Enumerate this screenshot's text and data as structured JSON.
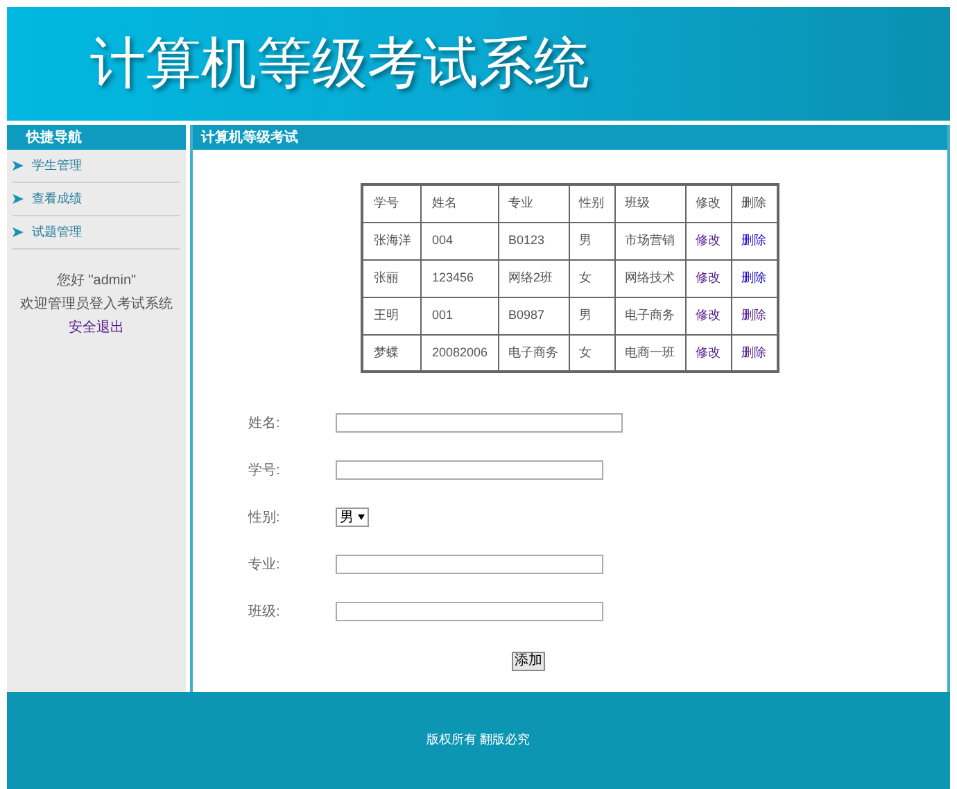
{
  "header": {
    "title": "计算机等级考试系统"
  },
  "sidebar": {
    "title": "快捷导航",
    "items": [
      {
        "label": "学生管理"
      },
      {
        "label": "查看成绩"
      },
      {
        "label": "试题管理"
      }
    ],
    "greeting": "您好 \"admin\"",
    "welcome": "欢迎管理员登入考试系统",
    "logout": "安全退出"
  },
  "main": {
    "title": "计算机等级考试",
    "table": {
      "columns": [
        "学号",
        "姓名",
        "专业",
        "性别",
        "班级",
        "修改",
        "删除"
      ],
      "rows": [
        {
          "cells": [
            "张海洋",
            "004",
            "B0123",
            "男",
            "市场营销"
          ],
          "edit": "修改",
          "delete": "删除",
          "delete_visited": false
        },
        {
          "cells": [
            "张丽",
            "123456",
            "网络2班",
            "女",
            "网络技术"
          ],
          "edit": "修改",
          "delete": "删除",
          "delete_visited": false
        },
        {
          "cells": [
            "王明",
            "001",
            "B0987",
            "男",
            "电子商务"
          ],
          "edit": "修改",
          "delete": "删除",
          "delete_visited": true
        },
        {
          "cells": [
            "梦蝶",
            "20082006",
            "电子商务",
            "女",
            "电商一班"
          ],
          "edit": "修改",
          "delete": "删除",
          "delete_visited": true
        }
      ]
    },
    "form": {
      "fields": [
        {
          "label": "姓名:",
          "kind": "text",
          "wide": true
        },
        {
          "label": "学号:",
          "kind": "text",
          "wide": false
        },
        {
          "label": "性别:",
          "kind": "select",
          "value": "男"
        },
        {
          "label": "专业:",
          "kind": "text",
          "wide": false
        },
        {
          "label": "班级:",
          "kind": "text",
          "wide": false
        }
      ],
      "submit": "添加"
    }
  },
  "footer": {
    "text": "版权所有 翻版必究"
  }
}
